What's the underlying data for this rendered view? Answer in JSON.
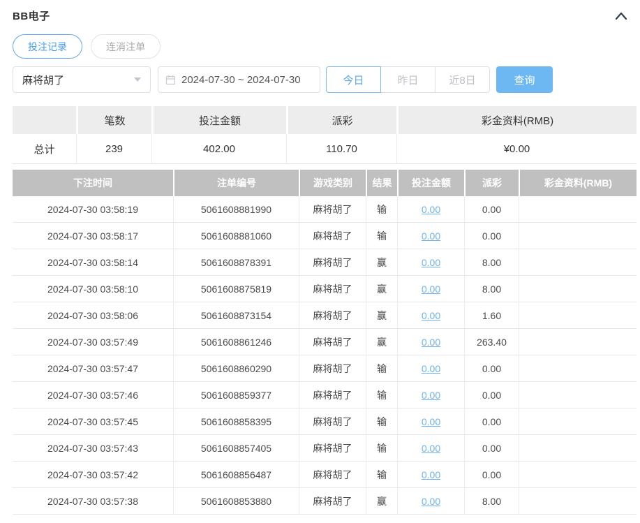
{
  "header": {
    "title": "BB电子"
  },
  "tabs": [
    {
      "label": "投注记录",
      "active": true
    },
    {
      "label": "连消注单",
      "active": false
    }
  ],
  "filters": {
    "game_select": {
      "value": "麻将胡了"
    },
    "date_range": {
      "value": "2024-07-30 ~ 2024-07-30"
    },
    "quick_buttons": [
      {
        "label": "今日",
        "active": true
      },
      {
        "label": "昨日",
        "active": false
      },
      {
        "label": "近8日",
        "active": false
      }
    ],
    "search_label": "查询"
  },
  "summary": {
    "headers": [
      "",
      "笔数",
      "投注金额",
      "派彩",
      "彩金资料(RMB)"
    ],
    "total": {
      "label": "总计",
      "count": "239",
      "bet_amount": "402.00",
      "payout": "110.70",
      "bonus": "¥0.00"
    }
  },
  "table": {
    "headers": [
      "下注时间",
      "注单编号",
      "游戏类别",
      "结果",
      "投注金额",
      "派彩",
      "彩金资料(RMB)"
    ],
    "rows": [
      [
        "2024-07-30 03:58:19",
        "5061608881990",
        "麻将胡了",
        "输",
        "0.00",
        "0.00",
        ""
      ],
      [
        "2024-07-30 03:58:17",
        "5061608881060",
        "麻将胡了",
        "输",
        "0.00",
        "0.00",
        ""
      ],
      [
        "2024-07-30 03:58:14",
        "5061608878391",
        "麻将胡了",
        "赢",
        "0.00",
        "8.00",
        ""
      ],
      [
        "2024-07-30 03:58:10",
        "5061608875819",
        "麻将胡了",
        "赢",
        "0.00",
        "8.00",
        ""
      ],
      [
        "2024-07-30 03:58:06",
        "5061608873154",
        "麻将胡了",
        "赢",
        "0.00",
        "1.60",
        ""
      ],
      [
        "2024-07-30 03:57:49",
        "5061608861246",
        "麻将胡了",
        "赢",
        "0.00",
        "263.40",
        ""
      ],
      [
        "2024-07-30 03:57:47",
        "5061608860290",
        "麻将胡了",
        "输",
        "0.00",
        "0.00",
        ""
      ],
      [
        "2024-07-30 03:57:46",
        "5061608859377",
        "麻将胡了",
        "输",
        "0.00",
        "0.00",
        ""
      ],
      [
        "2024-07-30 03:57:45",
        "5061608858395",
        "麻将胡了",
        "输",
        "0.00",
        "0.00",
        ""
      ],
      [
        "2024-07-30 03:57:43",
        "5061608857405",
        "麻将胡了",
        "输",
        "0.00",
        "0.00",
        ""
      ],
      [
        "2024-07-30 03:57:42",
        "5061608856487",
        "麻将胡了",
        "输",
        "0.00",
        "0.00",
        ""
      ],
      [
        "2024-07-30 03:57:38",
        "5061608853880",
        "麻将胡了",
        "赢",
        "0.00",
        "8.00",
        ""
      ]
    ]
  },
  "colors": {
    "accent_blue": "#459ff0",
    "search_button_blue": "#6db8f2",
    "link_blue": "#6db3ee",
    "table_header_bg": "#c0c0c0",
    "summary_header_bg": "#ededed",
    "chevron_dark": "#2f3c4e"
  }
}
